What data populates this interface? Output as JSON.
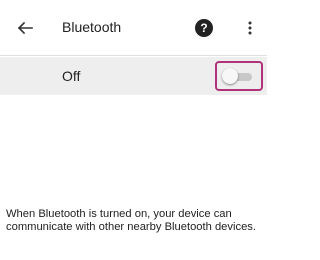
{
  "header": {
    "back_icon": "arrow-left-icon",
    "title": "Bluetooth",
    "help_icon": "help-circle-icon",
    "help_glyph": "?",
    "more_icon": "more-vert-icon"
  },
  "bluetooth_toggle": {
    "label": "Off",
    "state": "off"
  },
  "info": {
    "text": "When Bluetooth is turned on, your device can communicate with other nearby Bluetooth devices."
  },
  "colors": {
    "highlight_border": "#b0337a",
    "row_background": "#eeeeee"
  }
}
